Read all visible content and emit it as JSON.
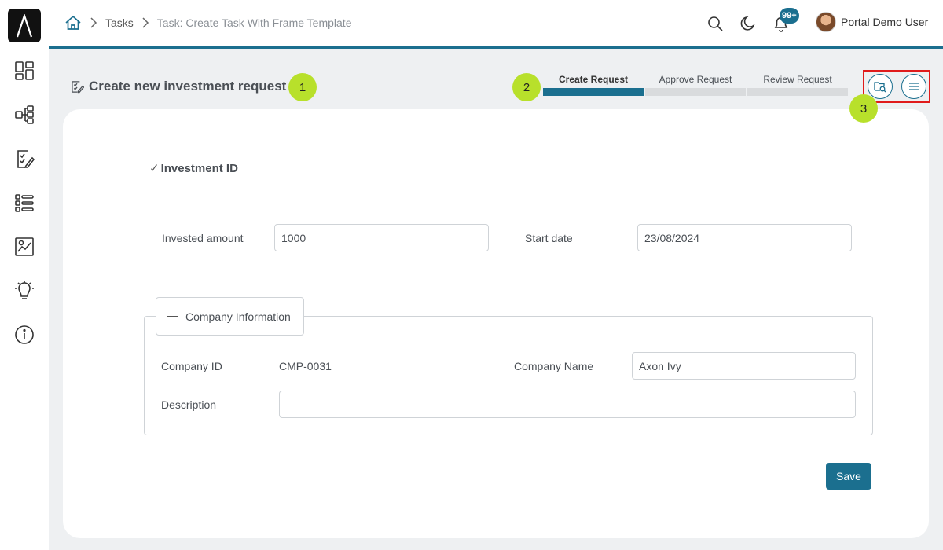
{
  "app": {
    "logo": "axon-ivy-logo"
  },
  "sidebar": {
    "items": [
      {
        "name": "dashboard-icon"
      },
      {
        "name": "processes-icon"
      },
      {
        "name": "tasks-icon"
      },
      {
        "name": "cases-icon"
      },
      {
        "name": "statistics-icon"
      },
      {
        "name": "ideas-icon"
      },
      {
        "name": "info-icon"
      }
    ]
  },
  "breadcrumb": {
    "home_icon": "home-icon",
    "items": [
      "Tasks",
      "Task: Create Task With Frame Template"
    ]
  },
  "topbar": {
    "notification_count": "99+",
    "user_name": "Portal Demo User"
  },
  "page": {
    "title": "Create new investment request",
    "markers": [
      "1",
      "2",
      "3"
    ],
    "steps": [
      {
        "label": "Create Request",
        "active": true
      },
      {
        "label": "Approve Request",
        "active": false
      },
      {
        "label": "Review Request",
        "active": false
      }
    ]
  },
  "form": {
    "section_title": "Investment ID",
    "invested_amount_label": "Invested amount",
    "invested_amount_value": "1000",
    "start_date_label": "Start date",
    "start_date_value": "23/08/2024",
    "company": {
      "legend": "Company Information",
      "company_id_label": "Company ID",
      "company_id_value": "CMP-0031",
      "company_name_label": "Company Name",
      "company_name_value": "Axon Ivy",
      "description_label": "Description",
      "description_value": ""
    },
    "save_label": "Save"
  },
  "colors": {
    "accent": "#1b6f8f",
    "marker": "#b8e02b",
    "highlight_box": "#e01b1b"
  }
}
